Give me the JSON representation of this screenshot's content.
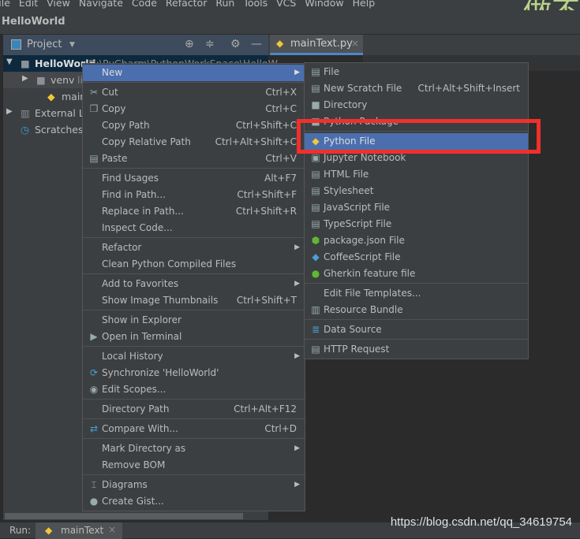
{
  "menubar": [
    "File",
    "Edit",
    "View",
    "Navigate",
    "Code",
    "Refactor",
    "Run",
    "Tools",
    "VCS",
    "Window",
    "Help"
  ],
  "decoration": "做不",
  "breadcrumb": "HelloWorld",
  "project_panel": {
    "title": "Project"
  },
  "editor_tab": {
    "label": "mainText.py"
  },
  "tree": [
    {
      "label": "HelloWorld",
      "extra": "D:\\PyCharm\\PythonWorkSpace\\HelloW",
      "expanded": true,
      "icon": "folder-icon"
    },
    {
      "label": "venv",
      "extra": "lib",
      "icon": "folder-icon"
    },
    {
      "label": "mainText.py",
      "icon": "python-file-icon"
    },
    {
      "label": "External Libraries",
      "icon": "library-icon"
    },
    {
      "label": "Scratches and Consoles",
      "icon": "scratches-icon"
    }
  ],
  "context_menu": [
    {
      "label": "New",
      "submenu": true,
      "selected": true
    },
    {
      "sep": true
    },
    {
      "label": "Cut",
      "shortcut": "Ctrl+X",
      "icon": "scissors-icon",
      "glyph": "✂"
    },
    {
      "label": "Copy",
      "shortcut": "Ctrl+C",
      "icon": "copy-icon",
      "glyph": "❐"
    },
    {
      "label": "Copy Path",
      "shortcut": "Ctrl+Shift+C"
    },
    {
      "label": "Copy Relative Path",
      "shortcut": "Ctrl+Alt+Shift+C"
    },
    {
      "label": "Paste",
      "shortcut": "Ctrl+V",
      "icon": "paste-icon",
      "glyph": "▤"
    },
    {
      "sep": true
    },
    {
      "label": "Find Usages",
      "shortcut": "Alt+F7"
    },
    {
      "label": "Find in Path...",
      "shortcut": "Ctrl+Shift+F"
    },
    {
      "label": "Replace in Path...",
      "shortcut": "Ctrl+Shift+R"
    },
    {
      "label": "Inspect Code..."
    },
    {
      "sep": true
    },
    {
      "label": "Refactor",
      "submenu": true
    },
    {
      "label": "Clean Python Compiled Files"
    },
    {
      "sep": true
    },
    {
      "label": "Add to Favorites",
      "submenu": true
    },
    {
      "label": "Show Image Thumbnails",
      "shortcut": "Ctrl+Shift+T"
    },
    {
      "sep": true
    },
    {
      "label": "Show in Explorer"
    },
    {
      "label": "Open in Terminal",
      "icon": "terminal-icon",
      "glyph": "▶"
    },
    {
      "sep": true
    },
    {
      "label": "Local History",
      "submenu": true
    },
    {
      "label": "Synchronize 'HelloWorld'",
      "icon": "sync-icon",
      "glyph": "⟳"
    },
    {
      "label": "Edit Scopes...",
      "icon": "scope-icon",
      "glyph": "◉"
    },
    {
      "sep": true
    },
    {
      "label": "Directory Path",
      "shortcut": "Ctrl+Alt+F12"
    },
    {
      "sep": true
    },
    {
      "label": "Compare With...",
      "shortcut": "Ctrl+D",
      "icon": "compare-icon",
      "glyph": "⇄"
    },
    {
      "sep": true
    },
    {
      "label": "Mark Directory as",
      "submenu": true
    },
    {
      "label": "Remove BOM"
    },
    {
      "sep": true
    },
    {
      "label": "Diagrams",
      "submenu": true,
      "icon": "diagram-icon",
      "glyph": "⌶"
    },
    {
      "label": "Create Gist...",
      "icon": "github-icon",
      "glyph": "●"
    }
  ],
  "new_submenu": [
    {
      "label": "File",
      "icon": "file-icon",
      "glyph": "▤"
    },
    {
      "label": "New Scratch File",
      "shortcut": "Ctrl+Alt+Shift+Insert",
      "icon": "scratch-file-icon",
      "glyph": "▤"
    },
    {
      "label": "Directory",
      "icon": "folder-icon",
      "glyph": "■"
    },
    {
      "label": "Python Package",
      "icon": "package-icon",
      "glyph": "■"
    },
    {
      "sep": true
    },
    {
      "label": "Python File",
      "selected": true,
      "icon": "python-file-icon",
      "glyph": "◆"
    },
    {
      "label": "Jupyter Notebook",
      "icon": "jupyter-icon",
      "glyph": "▣"
    },
    {
      "label": "HTML File",
      "icon": "html-file-icon",
      "glyph": "▤"
    },
    {
      "label": "Stylesheet",
      "icon": "css-file-icon",
      "glyph": "▤"
    },
    {
      "label": "JavaScript File",
      "icon": "js-file-icon",
      "glyph": "▤"
    },
    {
      "label": "TypeScript File",
      "icon": "ts-file-icon",
      "glyph": "▤"
    },
    {
      "label": "package.json File",
      "icon": "nodejs-icon",
      "glyph": "⬢"
    },
    {
      "label": "CoffeeScript File",
      "icon": "coffeescript-icon",
      "glyph": "◆"
    },
    {
      "label": "Gherkin feature file",
      "icon": "gherkin-icon",
      "glyph": "●"
    },
    {
      "sep": true
    },
    {
      "label": "Edit File Templates..."
    },
    {
      "label": "Resource Bundle",
      "icon": "resource-bundle-icon",
      "glyph": "▥"
    },
    {
      "sep": true
    },
    {
      "label": "Data Source",
      "icon": "database-icon",
      "glyph": "≣"
    },
    {
      "sep": true
    },
    {
      "label": "HTTP Request",
      "icon": "http-request-icon",
      "glyph": "▤"
    }
  ],
  "run_bar": {
    "label": "Run:",
    "tab": "mainText"
  },
  "watermark": "https://blog.csdn.net/qq_34619754",
  "colors": {
    "selection": "#4b6eaf",
    "highlight_box": "#f0302c",
    "panel": "#3c3f41",
    "editor": "#2b2b2b"
  }
}
